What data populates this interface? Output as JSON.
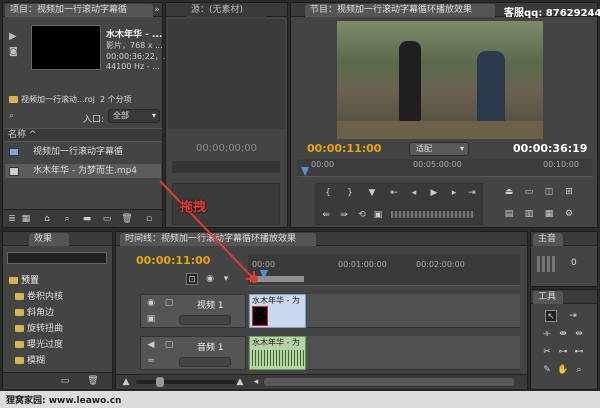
{
  "project": {
    "tab_label": "项目：视频加一行滚动字幕循",
    "clip_name": "水木年华 - ...",
    "clip_meta": [
      "影片，768 x ...",
      "00;00;36;22，...",
      "44100 Hz - ..."
    ],
    "project_file": "视频加一行滚动...roj",
    "item_count": "2 个分项",
    "entry_label": "入口:",
    "entry_value": "全部",
    "column_name": "名称",
    "items": [
      {
        "name": "视频加一行滚动字幕循",
        "icon": "sequence-icon"
      },
      {
        "name": "水木年华 - 为梦而生.mp4",
        "icon": "film-icon"
      }
    ]
  },
  "source": {
    "tab_label": "源：(无素材)",
    "timecode": "00;00;00;00"
  },
  "program": {
    "tab_label": "节目：视频加一行滚动字幕循环播放效果",
    "timecode_left": "00:00:11:00",
    "fit_label": "适配",
    "timecode_right": "00:00:36:19",
    "ruler": [
      "00:00",
      "00:05:00:00",
      "00:10:00"
    ]
  },
  "watermark": {
    "qq": "客服qq: 876292449",
    "footer": "狸窝家园: www.leawo.cn"
  },
  "annotation": {
    "drag_label": "拖拽"
  },
  "effects": {
    "tab_label": "效果",
    "folders": [
      "预置",
      "卷积内核",
      "斜角边",
      "旋转扭曲",
      "曝光过度",
      "模糊"
    ]
  },
  "timeline": {
    "tab_label": "时间线：视频加一行滚动字幕循环播放效果",
    "timecode": "00:00:11:00",
    "ruler": [
      "00:00",
      "00:01:00:00",
      "00:02:00:00"
    ],
    "video_track": "视频 1",
    "audio_track": "音频 1",
    "video_clip": "水木年华 - 为",
    "audio_clip": "水木年华 - 为"
  },
  "audio_master": {
    "tab_label": "主音",
    "value": "0"
  },
  "tools": {
    "tab_label": "工具"
  },
  "colors": {
    "accent": "#e8a800",
    "annotation": "#e23b2e",
    "panel": "#444444"
  }
}
